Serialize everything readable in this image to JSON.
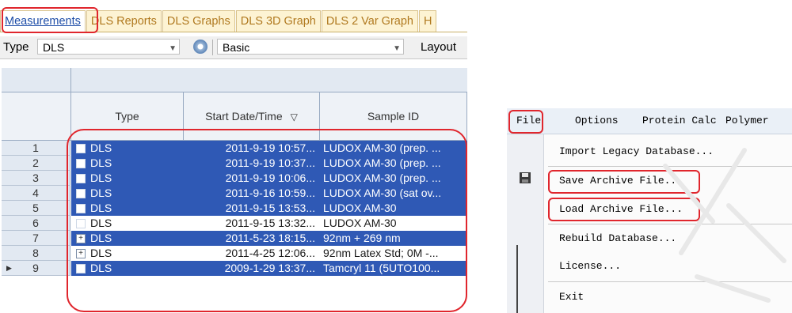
{
  "tabs": [
    "Measurements",
    "DLS Reports",
    "DLS Graphs",
    "DLS 3D Graph",
    "DLS 2 Var Graph",
    "H"
  ],
  "toolbar": {
    "type_label": "Type",
    "type_value": "DLS",
    "dropdown_icon": "chevron-down-icon",
    "refresh_icon": "gear-icon",
    "view_value": "Basic",
    "layout_label": "Layout"
  },
  "grid": {
    "columns": [
      "Type",
      "Start Date/Time",
      "Sample ID"
    ],
    "sort_indicator": "▽",
    "rows": [
      {
        "num": "1",
        "type": "DLS",
        "date": "2011-9-19 10:57...",
        "sample": "LUDOX AM-30 (prep. ...",
        "selected": true
      },
      {
        "num": "2",
        "type": "DLS",
        "date": "2011-9-19 10:37...",
        "sample": "LUDOX AM-30 (prep. ...",
        "selected": true
      },
      {
        "num": "3",
        "type": "DLS",
        "date": "2011-9-19 10:06...",
        "sample": "LUDOX AM-30 (prep. ...",
        "selected": true
      },
      {
        "num": "4",
        "type": "DLS",
        "date": "2011-9-16 10:59...",
        "sample": "LUDOX AM-30 (sat ov...",
        "selected": true
      },
      {
        "num": "5",
        "type": "DLS",
        "date": "2011-9-15 13:53...",
        "sample": "LUDOX AM-30",
        "selected": true
      },
      {
        "num": "6",
        "type": "DLS",
        "date": "2011-9-15 13:32...",
        "sample": "LUDOX AM-30",
        "selected": false
      },
      {
        "num": "7",
        "type": "DLS",
        "date": "2011-5-23 18:15...",
        "sample": "92nm + 269 nm",
        "selected": true,
        "expand": true
      },
      {
        "num": "8",
        "type": "DLS",
        "date": "2011-4-25 12:06...",
        "sample": "92nm Latex Std; 0M -...",
        "selected": false,
        "expand": true
      },
      {
        "num": "9",
        "type": "DLS",
        "date": "2009-1-29 13:37...",
        "sample": "Tamcryl 11 (5UTO100...",
        "selected": true,
        "current": true
      }
    ]
  },
  "menubar": [
    "File",
    "Options",
    "Protein Calc",
    "Polymer"
  ],
  "file_menu": [
    "Import Legacy Database...",
    "Save Archive File...",
    "Load Archive File...",
    "Rebuild Database...",
    "License...",
    "Exit"
  ],
  "colors": {
    "selection": "#2f59b5",
    "highlight": "#e0262d",
    "tab_text": "#b0791f"
  }
}
